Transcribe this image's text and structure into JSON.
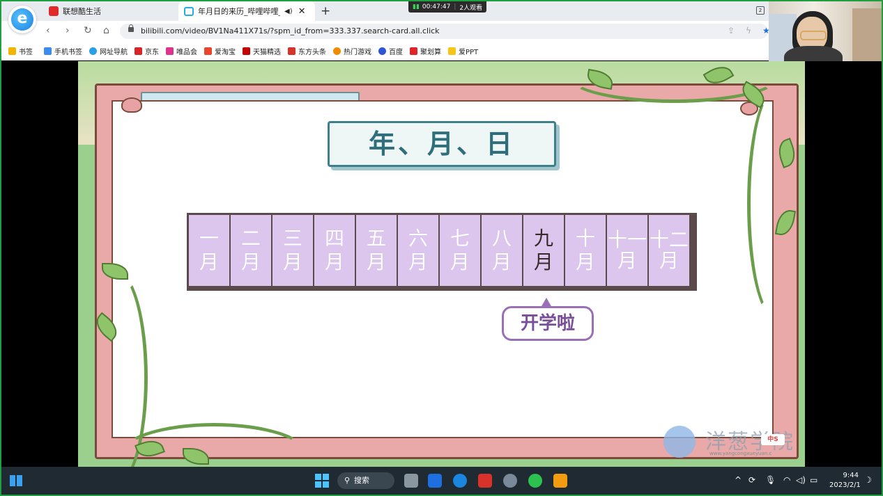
{
  "browser": {
    "tabs": [
      {
        "title": "联想酷生活",
        "active": false
      },
      {
        "title": "年月日的来历_哔哩哔哩_bi",
        "active": true
      }
    ],
    "new_tab_label": "+",
    "url": "bilibili.com/video/BV1Na411X71s/?spm_id_from=333.337.search-card.all.click",
    "bookmarks": [
      "书签",
      "手机书签",
      "网址导航",
      "京东",
      "唯品会",
      "爱淘宝",
      "天猫精选",
      "东方头条",
      "热门游戏",
      "百度",
      "聚划算",
      "爱PPT"
    ]
  },
  "live": {
    "time": "00:47:47",
    "viewers": "2人观看"
  },
  "video": {
    "title": "年、月、日",
    "months": [
      {
        "top": "一",
        "bottom": "月",
        "active": false
      },
      {
        "top": "二",
        "bottom": "月",
        "active": false
      },
      {
        "top": "三",
        "bottom": "月",
        "active": false
      },
      {
        "top": "四",
        "bottom": "月",
        "active": false
      },
      {
        "top": "五",
        "bottom": "月",
        "active": false
      },
      {
        "top": "六",
        "bottom": "月",
        "active": false
      },
      {
        "top": "七",
        "bottom": "月",
        "active": false
      },
      {
        "top": "八",
        "bottom": "月",
        "active": false
      },
      {
        "top": "九",
        "bottom": "月",
        "active": true
      },
      {
        "top": "十",
        "bottom": "月",
        "active": false
      },
      {
        "top": "十一",
        "bottom": "月",
        "active": false
      },
      {
        "top": "十二",
        "bottom": "月",
        "active": false
      }
    ],
    "bubble": "开学啦",
    "watermark": "洋葱学院",
    "watermark_url": "www.yangcongxueyuan.c"
  },
  "taskbar": {
    "search_label": "搜索",
    "time": "9:44",
    "date": "2023/2/1"
  },
  "colors": {
    "month_cell": "#dcc6ee",
    "title_teal": "#2f6f7c",
    "bubble_purple": "#7a4f9a",
    "frame_green": "#1fa040"
  }
}
